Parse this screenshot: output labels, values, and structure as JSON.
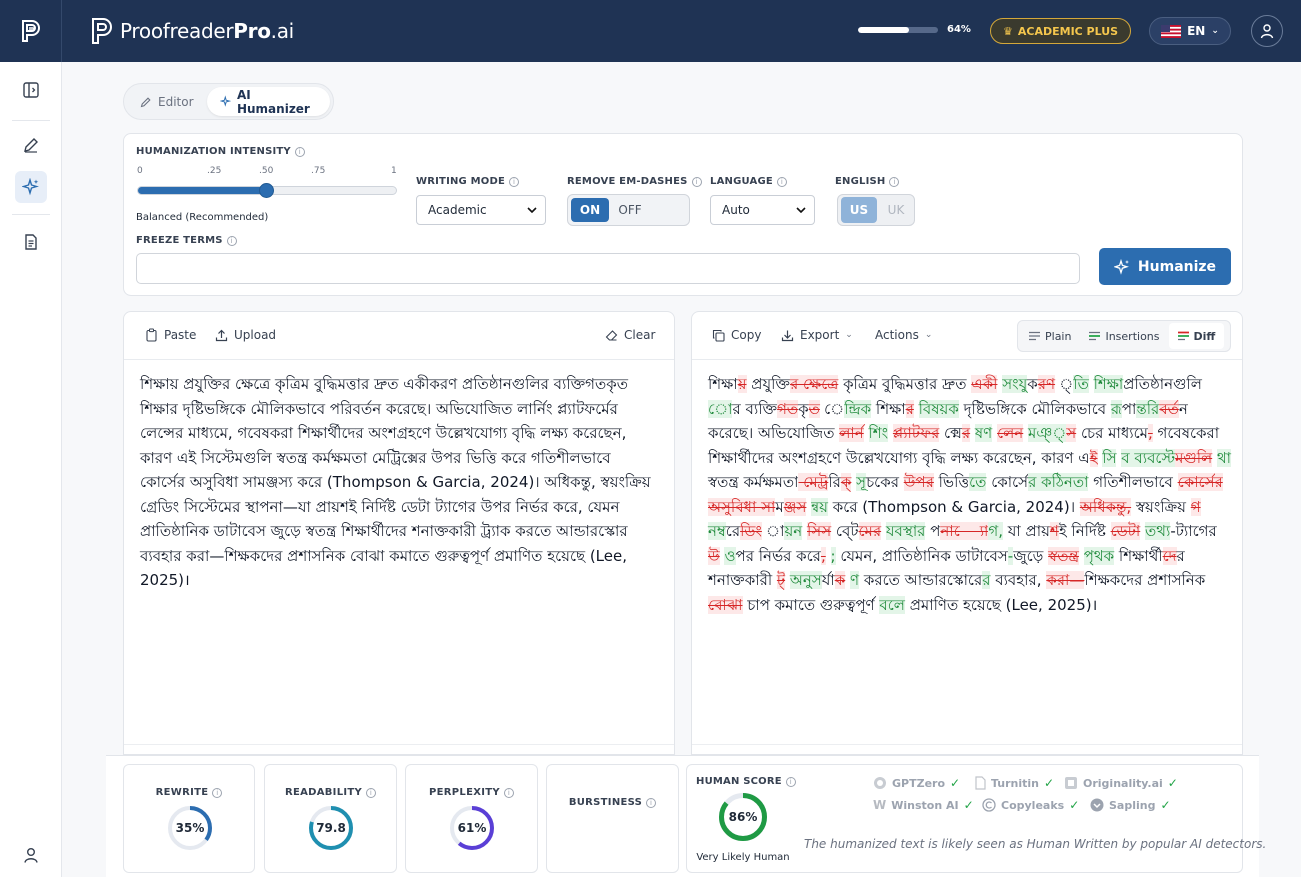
{
  "header": {
    "brand_main": "Proofreader",
    "brand_pro": "Pro",
    "brand_tld": ".ai",
    "usage_percent": 64,
    "usage_label": "64%",
    "plan_label": "ACADEMIC PLUS",
    "language_code": "EN"
  },
  "mode_tabs": [
    {
      "label": "Editor"
    },
    {
      "label": "AI Humanizer"
    }
  ],
  "settings": {
    "intensity_label": "HUMANIZATION INTENSITY",
    "intensity_ticks": [
      "0",
      ".25",
      ".50",
      ".75",
      "1"
    ],
    "intensity_value": 0.5,
    "intensity_note": "Balanced (Recommended)",
    "writing_mode_label": "WRITING MODE",
    "writing_mode_value": "Academic",
    "em_dash_label": "REMOVE EM-DASHES",
    "em_dash_on": "ON",
    "em_dash_off": "OFF",
    "language_label": "LANGUAGE",
    "language_value": "Auto",
    "english_label": "ENGLISH",
    "english_us": "US",
    "english_uk": "UK",
    "freeze_label": "FREEZE TERMS",
    "freeze_placeholder": "",
    "humanize_label": "Humanize"
  },
  "left_panel": {
    "paste": "Paste",
    "upload": "Upload",
    "clear": "Clear",
    "text": "শিক্ষায় প্রযুক্তির ক্ষেত্রে কৃত্রিম বুদ্ধিমত্তার দ্রুত একীকরণ প্রতিষ্ঠানগুলির ব্যক্তিগতকৃত শিক্ষার দৃষ্টিভঙ্গিকে মৌলিকভাবে পরিবর্তন করেছে। অভিযোজিত লার্নিং প্ল্যাটফর্মের লেন্সের মাধ্যমে, গবেষকরা শিক্ষার্থীদের অংশগ্রহণে উল্লেখযোগ্য বৃদ্ধি লক্ষ্য করেছেন, কারণ এই সিস্টেমগুলি স্বতন্ত্র কর্মক্ষমতা মেট্রিক্সের উপর ভিত্তি করে গতিশীলভাবে কোর্সের অসুবিধা সামঞ্জস্য করে (Thompson & Garcia, 2024)। অধিকন্তু, স্বয়ংক্রিয় গ্রেডিং সিস্টেমের স্থাপনা—যা প্রায়শই নির্দিষ্ট ডেটা ট্যাগের উপর নির্ভর করে, যেমন প্রাতিষ্ঠানিক ডাটাবেস জুড়ে স্বতন্ত্র শিক্ষার্থীদের শনাক্তকারী ট্র্যাক করতে আন্ডারস্কোর ব্যবহার করা—শিক্ষকদের প্রশাসনিক বোঝা কমাতে গুরুত্বপূর্ণ প্রমাণিত হয়েছে (Lee, 2025)।"
  },
  "right_panel": {
    "copy": "Copy",
    "export": "Export",
    "actions": "Actions",
    "view_plain": "Plain",
    "view_insertions": "Insertions",
    "view_diff": "Diff",
    "diff": [
      {
        "t": "n",
        "s": "শিক্ষা"
      },
      {
        "t": "d",
        "s": "য়"
      },
      {
        "t": "n",
        "s": " প্রযুক্তি"
      },
      {
        "t": "d",
        "s": "র ক্ষেত"
      },
      {
        "t": "n",
        "s": "্"
      },
      {
        "t": "d",
        "s": "রে"
      },
      {
        "t": "n",
        "s": " কৃত্রিম বুদ্ধিমত্তার দ্রুত "
      },
      {
        "t": "d",
        "s": "একী"
      },
      {
        "t": "n",
        "s": " "
      },
      {
        "t": "i",
        "s": "সংযু"
      },
      {
        "t": "n",
        "s": "ক"
      },
      {
        "t": "d",
        "s": "রণ"
      },
      {
        "t": "n",
        "s": " "
      },
      {
        "t": "i",
        "s": "্তি"
      },
      {
        "t": "n",
        "s": " "
      },
      {
        "t": "i",
        "s": "শিক্ষা"
      },
      {
        "t": "n",
        "s": "প্রতিষ্ঠানগুল"
      },
      {
        "t": "d",
        "s": "ি"
      },
      {
        "t": "n",
        "s": " "
      },
      {
        "t": "i",
        "s": "ো"
      },
      {
        "t": "n",
        "s": "র ব্যক্তি"
      },
      {
        "t": "d",
        "s": "গত"
      },
      {
        "t": "n",
        "s": "ক"
      },
      {
        "t": "d",
        "s": "ৃত"
      },
      {
        "t": "n",
        "s": " "
      },
      {
        "t": "i",
        "s": "েন্দ্রিক"
      },
      {
        "t": "n",
        "s": " শিক্ষা"
      },
      {
        "t": "d",
        "s": "র"
      },
      {
        "t": "n",
        "s": " "
      },
      {
        "t": "i",
        "s": "বিষয়ক"
      },
      {
        "t": "n",
        "s": " দৃষ্টিভঙ্গিকে মৌলিকভাবে "
      },
      {
        "t": "i",
        "s": "রূ"
      },
      {
        "t": "n",
        "s": "প"
      },
      {
        "t": "i",
        "s": "ান্তরি"
      },
      {
        "t": "d",
        "s": "বর্ত"
      },
      {
        "t": "n",
        "s": "ন"
      },
      {
        "t": "d",
        "s": " "
      },
      {
        "t": "n",
        "s": " করেছে। অভিযোজিত "
      },
      {
        "t": "d",
        "s": "লার্ন"
      },
      {
        "t": "n",
        "s": " "
      },
      {
        "t": "i",
        "s": "শ"
      },
      {
        "t": "d",
        "s": "িং"
      },
      {
        "t": "n",
        "s": " "
      },
      {
        "t": "d",
        "s": "প্ল্যাটফর"
      },
      {
        "t": "n",
        "s": " ক"
      },
      {
        "t": "i",
        "s": "্"
      },
      {
        "t": "d",
        "s": "মের"
      },
      {
        "t": "n",
        "s": " "
      },
      {
        "t": "i",
        "s": "ষণ"
      },
      {
        "t": "n",
        "s": " "
      },
      {
        "t": "d",
        "s": "লেন"
      },
      {
        "t": "n",
        "s": " "
      },
      {
        "t": "i",
        "s": "মঞ্"
      },
      {
        "t": "d",
        "s": "্স"
      },
      {
        "t": "n",
        "s": " চ"
      },
      {
        "t": "i",
        "s": "ে"
      },
      {
        "t": "n",
        "s": "র মাধ্যমে"
      },
      {
        "t": "d",
        "s": ","
      },
      {
        "t": "n",
        "s": " গবেষক"
      },
      {
        "t": "i",
        "s": "ে"
      },
      {
        "t": "n",
        "s": "রা শিক্ষার্থীদের অংশগ্রহণে উল্লেখযোগ্য বৃদ্ধি লক্ষ্য করেছেন, কারণ এ"
      },
      {
        "t": "d",
        "s": "ই"
      },
      {
        "t": "n",
        "s": " "
      },
      {
        "t": "i",
        "s": "স"
      },
      {
        "t": "d",
        "s": "ি"
      },
      {
        "t": "n",
        "s": " "
      },
      {
        "t": "i",
        "s": "ব ব্যবস্"
      },
      {
        "t": "d",
        "s": "টেমগুলি"
      },
      {
        "t": "n",
        "s": " "
      },
      {
        "t": "i",
        "s": "থা"
      },
      {
        "t": "n",
        "s": " স্বতন্ত্র কর্মক্ষমতা"
      },
      {
        "t": "d",
        "s": " মেট্র"
      },
      {
        "t": "n",
        "s": "র"
      },
      {
        "t": "d",
        "s": "িক্"
      },
      {
        "t": "n",
        "s": " "
      },
      {
        "t": "i",
        "s": "সূ"
      },
      {
        "t": "n",
        "s": "চক"
      },
      {
        "t": "i",
        "s": "ে"
      },
      {
        "t": "n",
        "s": "র "
      },
      {
        "t": "d",
        "s": "উপর"
      },
      {
        "t": "n",
        "s": " ভিত্তি"
      },
      {
        "t": "i",
        "s": "তে"
      },
      {
        "t": "n",
        "s": " ক"
      },
      {
        "t": "i",
        "s": "ো"
      },
      {
        "t": "n",
        "s": "র"
      },
      {
        "t": "i",
        "s": "্স"
      },
      {
        "t": "n",
        "s": "ে"
      },
      {
        "t": "i",
        "s": "র কঠিনতা"
      },
      {
        "t": "n",
        "s": " গতিশীলভাবে "
      },
      {
        "t": "d",
        "s": "কোর্"
      },
      {
        "t": "n",
        "s": "স"
      },
      {
        "t": "i",
        "s": "ে"
      },
      {
        "t": "d",
        "s": "র অসুবিধা সা"
      },
      {
        "t": "n",
        "s": "ম"
      },
      {
        "t": "d",
        "s": "ঞ্জস"
      },
      {
        "t": "n",
        "s": " "
      },
      {
        "t": "i",
        "s": "ন্"
      },
      {
        "t": "n",
        "s": "ব"
      },
      {
        "t": "i",
        "s": "য়"
      },
      {
        "t": "n",
        "s": " করে (Thompson & Garcia, 2024)। "
      },
      {
        "t": "d",
        "s": "অধিকন্তু,"
      },
      {
        "t": "n",
        "s": " স্বয়ংক্রিয় "
      },
      {
        "t": "d",
        "s": "গ"
      },
      {
        "t": "n",
        "s": " "
      },
      {
        "t": "i",
        "s": "নম"
      },
      {
        "t": "n",
        "s": "্বর"
      },
      {
        "t": "d",
        "s": "েডিং"
      },
      {
        "t": "n",
        "s": " "
      },
      {
        "t": "i",
        "s": "ায়ন"
      },
      {
        "t": "n",
        "s": " "
      },
      {
        "t": "d",
        "s": "সিস"
      },
      {
        "t": "n",
        "s": " ব"
      },
      {
        "t": "i",
        "s": "্"
      },
      {
        "t": "d",
        "s": "টেমের"
      },
      {
        "t": "n",
        "s": " "
      },
      {
        "t": "i",
        "s": "যবস্থার"
      },
      {
        "t": "n",
        "s": " প"
      },
      {
        "t": "d",
        "s": "না—"
      },
      {
        "t": "n",
        "s": "্য"
      },
      {
        "t": "i",
        "s": "োগ,"
      },
      {
        "t": "n",
        "s": " য"
      },
      {
        "t": "d",
        "s": "া"
      },
      {
        "t": "n",
        "s": " প্রায়"
      },
      {
        "t": "d",
        "s": "শ"
      },
      {
        "t": "n",
        "s": "ই নির্দিষ্ট "
      },
      {
        "t": "d",
        "s": "ডেটা"
      },
      {
        "t": "n",
        "s": " "
      },
      {
        "t": "i",
        "s": "তথ্য"
      },
      {
        "t": "n",
        "s": "-ট্যাগের "
      },
      {
        "t": "d",
        "s": "উ"
      },
      {
        "t": "n",
        "s": " "
      },
      {
        "t": "i",
        "s": "ও"
      },
      {
        "t": "n",
        "s": "পর নির্ভর করে"
      },
      {
        "t": "d",
        "s": ","
      },
      {
        "t": "n",
        "s": " "
      },
      {
        "t": "i",
        "s": ";"
      },
      {
        "t": "n",
        "s": " যেমন, প্রাতিষ্ঠানিক ডাটাবেস"
      },
      {
        "t": "i",
        "s": "-"
      },
      {
        "t": "n",
        "s": "জুড়ে "
      },
      {
        "t": "d",
        "s": "স্বতন্ত্র"
      },
      {
        "t": "n",
        "s": " "
      },
      {
        "t": "i",
        "s": "পৃথক"
      },
      {
        "t": "n",
        "s": " শিক্ষার্থী"
      },
      {
        "t": "d",
        "s": "দে"
      },
      {
        "t": "n",
        "s": "র শনাক্তকারী "
      },
      {
        "t": "d",
        "s": "ট্"
      },
      {
        "t": "n",
        "s": " "
      },
      {
        "t": "i",
        "s": "অনুস"
      },
      {
        "t": "n",
        "s": "র"
      },
      {
        "t": "d",
        "s": "্যাক"
      },
      {
        "t": "n",
        "s": " "
      },
      {
        "t": "i",
        "s": "ণ"
      },
      {
        "t": "n",
        "s": " করতে আন্ডারস্কোর"
      },
      {
        "t": "i",
        "s": "ের"
      },
      {
        "t": "n",
        "s": " ব্যবহার, "
      },
      {
        "t": "d",
        "s": "করা—"
      },
      {
        "t": "n",
        "s": "শিক্ষকদের প্রশাসনিক "
      },
      {
        "t": "d",
        "s": "বোঝা"
      },
      {
        "t": "n",
        "s": " চ"
      },
      {
        "t": "i",
        "s": "া"
      },
      {
        "t": "n",
        "s": "প কমাতে গুরুত্বপূর্ণ "
      },
      {
        "t": "i",
        "s": "বলে"
      },
      {
        "t": "n",
        "s": " প্রমাণিত হয়েছে (Lee, 2025)।"
      }
    ]
  },
  "metrics": [
    {
      "label": "REWRITE",
      "value_text": "35%",
      "value": 35,
      "color": "#2c6db0"
    },
    {
      "label": "READABILITY",
      "value_text": "79.8",
      "value": 79.8,
      "color": "#1f8fb0"
    },
    {
      "label": "PERPLEXITY",
      "value_text": "61%",
      "value": 61,
      "color": "#5a3fd6"
    },
    {
      "label": "BURSTINESS",
      "value_text": "",
      "value": null,
      "color": "#9ca3af"
    }
  ],
  "human_score": {
    "label": "HUMAN SCORE",
    "value_text": "86%",
    "value": 86,
    "color": "#1f9a44",
    "verdict": "Very Likely Human",
    "detectors": [
      {
        "name": "GPTZero",
        "icon": "gptzero-icon"
      },
      {
        "name": "Turnitin",
        "icon": "turnitin-icon"
      },
      {
        "name": "Originality.ai",
        "icon": "originality-icon"
      },
      {
        "name": "Winston AI",
        "icon": "winston-icon"
      },
      {
        "name": "Copyleaks",
        "icon": "copyleaks-icon"
      },
      {
        "name": "Sapling",
        "icon": "sapling-icon"
      }
    ],
    "note": "The humanized text is likely seen as Human Written by popular AI detectors."
  }
}
